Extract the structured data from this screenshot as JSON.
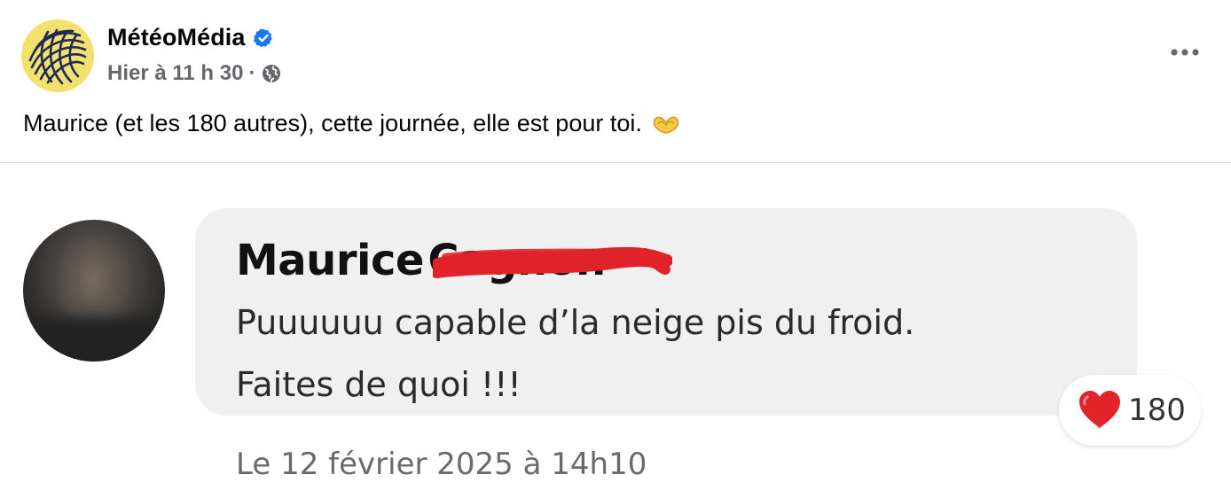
{
  "post": {
    "page_name": "MétéoMédia",
    "meta_time": "Hier à 11 h 30",
    "meta_separator": "·",
    "privacy_icon": "globe-icon",
    "verified_icon": "verified-badge-icon",
    "more_icon": "more-options-icon",
    "text": "Maurice (et les 180 autres), cette journée, elle est pour toi.",
    "text_emoji_icon": "heart-hands-icon"
  },
  "comment": {
    "first_name": "Maurice",
    "surname_redacted": "Cagnon",
    "line1": "Puuuuuu capable d’la neige pis du froid.",
    "line2": "Faites de quoi !!!",
    "reaction_icon": "heart-icon",
    "reaction_count": "180",
    "timestamp": "Le 12 février 2025 à 14h10"
  },
  "colors": {
    "verified_blue": "#1877f2",
    "meta_gray": "#65676b",
    "logo_yellow": "#f3e16d",
    "logo_navy": "#1f2a5a",
    "bubble_gray": "#f0f0f0",
    "heart_red": "#e0242a",
    "redaction_red": "#e0232a"
  }
}
